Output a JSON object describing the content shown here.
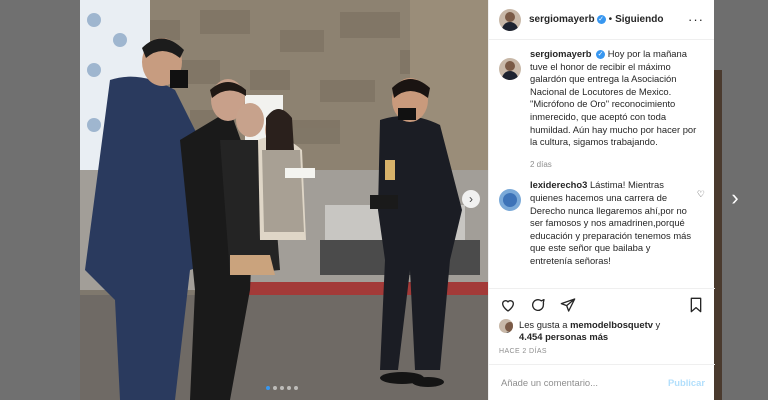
{
  "post": {
    "username": "sergiomayerb",
    "follow_status": "Siguiendo",
    "separator": "•",
    "caption_user": "sergiomayerb",
    "caption": "Hoy por la mañana tuve el honor de recibir el máximo galardón que entrega la Asociación Nacional de Locutores de Mexico. \"Micrófono de Oro\" reconocimiento inmerecido, que aceptó con toda humildad. Aún hay mucho por hacer por la cultura, sigamos trabajando.",
    "caption_time": "2 días"
  },
  "comments": [
    {
      "user": "lexiderecho3",
      "text": "Lástima! Mientras quienes hacemos una carrera de Derecho nunca llegaremos ahí,por no ser famosos y nos amadrinen,porqué educación y preparación tenemos más que este señor que bailaba y entretenía señoras!"
    }
  ],
  "likes": {
    "prefix": "Les gusta a",
    "user": "memodelbosquetv",
    "joiner": "y",
    "count": "4.454 personas más"
  },
  "timestamp": "HACE 2 DÍAS",
  "composer": {
    "placeholder": "Añade un comentario...",
    "publish_label": "Publicar"
  },
  "carousel": {
    "dot_count": 5,
    "active_index": 0
  },
  "icons": {
    "heart": "heart-icon",
    "comment": "comment-icon",
    "share": "share-icon",
    "save": "bookmark-icon",
    "more": "more-options-icon",
    "verified": "verified-badge-icon",
    "next": "chevron-right-icon"
  },
  "colors": {
    "accent": "#3897f0",
    "publish_disabled": "#b2dffc",
    "text": "#262626",
    "muted": "#8e8e8e"
  }
}
